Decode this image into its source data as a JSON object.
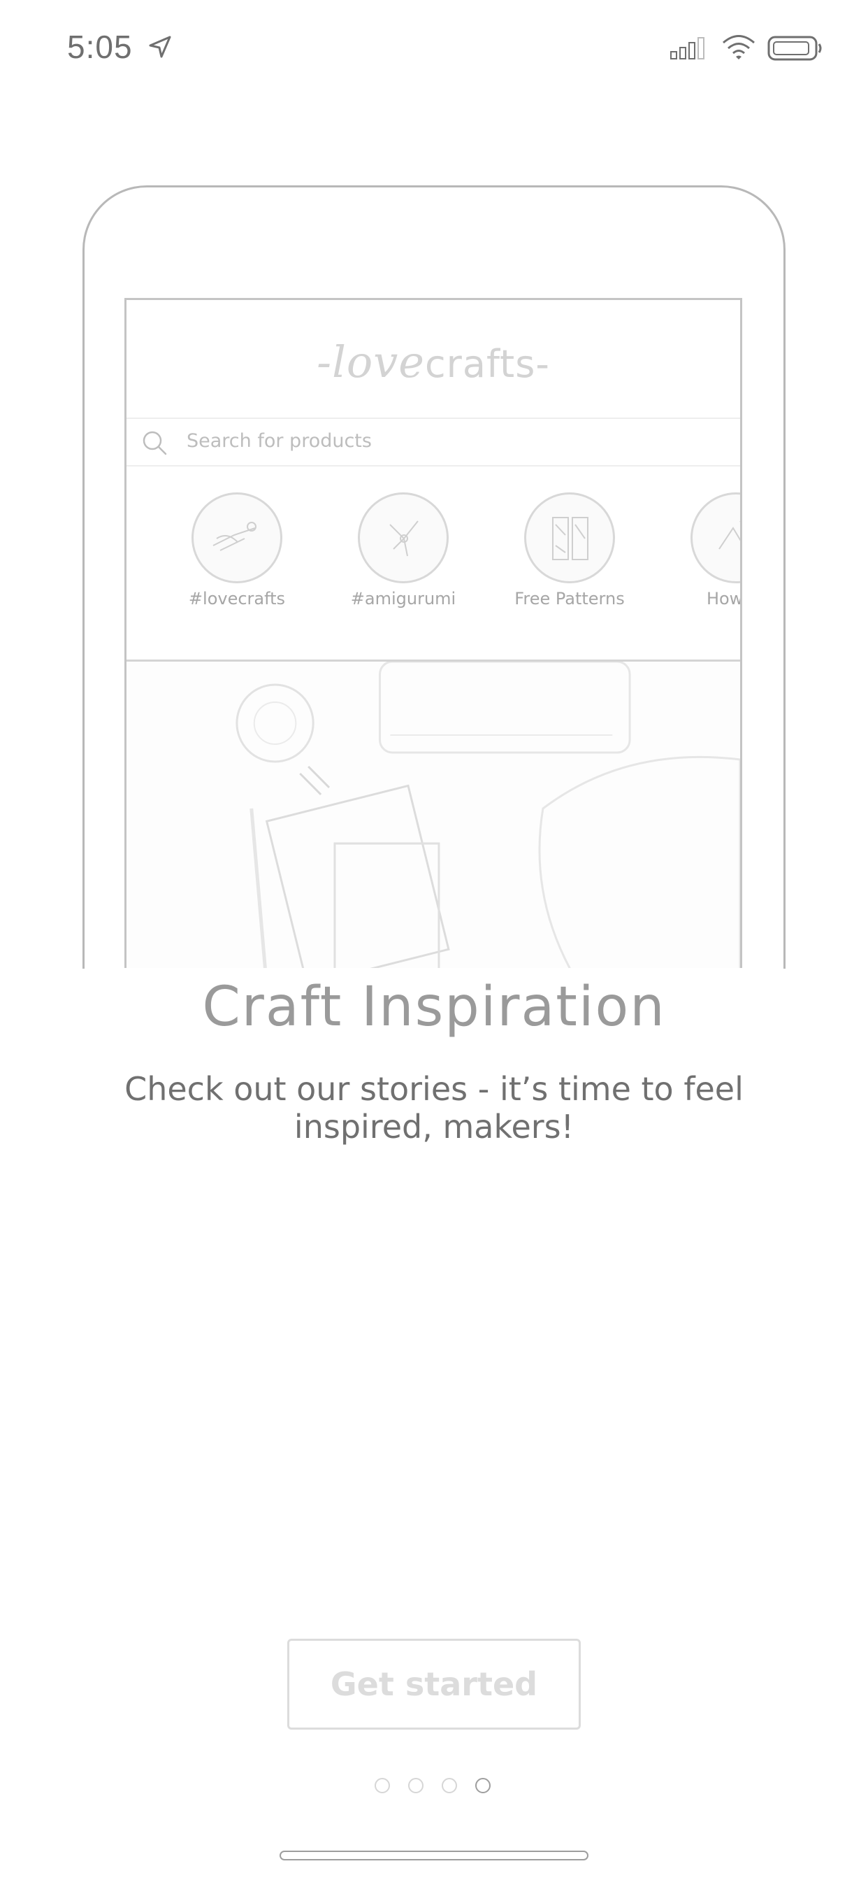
{
  "status_bar": {
    "time": "5:05",
    "icons": [
      "location-arrow-icon",
      "cellular-signal-icon",
      "wifi-icon",
      "battery-icon"
    ]
  },
  "illustration": {
    "logo_love": "-love",
    "logo_crafts": "crafts-",
    "search_placeholder": "Search for products",
    "categories": [
      {
        "label": "#lovecrafts",
        "icon": "lovecrafts-category-icon"
      },
      {
        "label": "#amigurumi",
        "icon": "amigurumi-category-icon"
      },
      {
        "label": "Free Patterns",
        "icon": "free-patterns-category-icon"
      },
      {
        "label": "How to",
        "icon": "how-to-category-icon"
      }
    ]
  },
  "onboarding": {
    "title": "Craft Inspiration",
    "subtitle": "Check out our stories - it’s time to feel inspired, makers!",
    "get_started_label": "Get started",
    "page_count": 4,
    "active_page": 4
  },
  "colors": {
    "frame": "#b8b8b8",
    "title": "#9a9a9a",
    "subtitle": "#707070",
    "button_disabled": "#dcdcdc"
  }
}
